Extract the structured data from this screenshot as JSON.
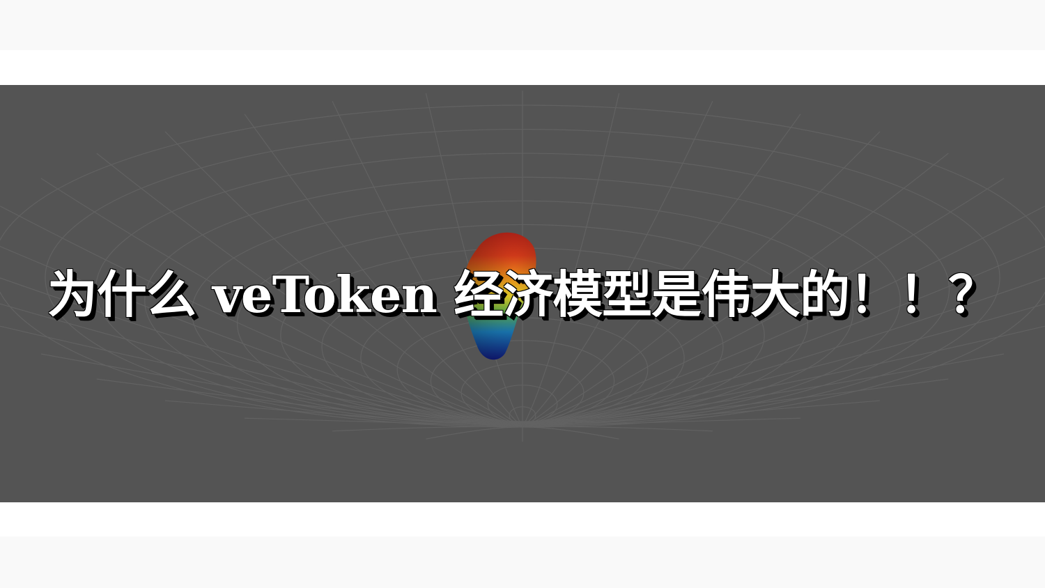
{
  "banner": {
    "title": "为什么 veToken 经济模型是伟大的！！？",
    "background_color": "#545454",
    "text_color": "#ffffff",
    "shadow_color": "#000000"
  },
  "background": {
    "pattern": "funnel-grid",
    "line_color": "#dddddd"
  },
  "logo": {
    "icon": "curve-finance-rainbow-logo-icon",
    "colors": [
      "#d7281b",
      "#e88a1a",
      "#f2d92a",
      "#4ab84a",
      "#1f8fd6",
      "#1a2fa8"
    ]
  }
}
